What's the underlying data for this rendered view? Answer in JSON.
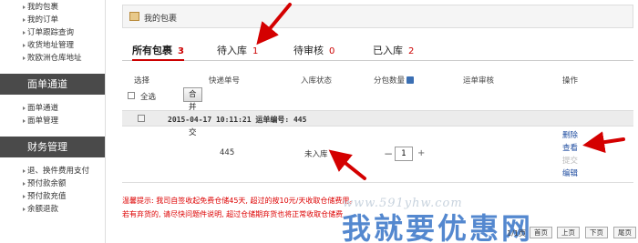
{
  "sidebar": {
    "group1": [
      "我的包裹",
      "我的订单",
      "订单跟踪查询",
      "收货地址管理",
      "败欧洲仓库地址"
    ],
    "section2": "面单通道",
    "group2": [
      "面单通道",
      "面单管理"
    ],
    "section3": "财务管理",
    "group3": [
      "退、换件费用支付",
      "预付款余额",
      "预付款充值",
      "余额退款"
    ]
  },
  "panel": {
    "title": "我的包裹"
  },
  "tabs": [
    {
      "label": "所有包裹",
      "count": "3"
    },
    {
      "label": "待入库",
      "count": "1"
    },
    {
      "label": "待审核",
      "count": "0"
    },
    {
      "label": "已入库",
      "count": "2"
    }
  ],
  "columns": {
    "select": "选择",
    "tracking": "快递单号",
    "status": "入库状态",
    "quantity": "分包数量",
    "waybill_review": "运单审核",
    "actions": "操作"
  },
  "toolbar": {
    "select_all": "全选",
    "merge_submit": "合并提交"
  },
  "order": {
    "info": "2015-04-17 10:11:21 运单编号: 445"
  },
  "row": {
    "tracking": "445",
    "status": "未入库",
    "quantity": "1",
    "minus": "−",
    "plus": "+",
    "actions": {
      "delete": "删除",
      "view": "查看",
      "submit": "提交",
      "edit": "编辑"
    }
  },
  "tips": {
    "line1": "温馨提示: 我司自签收起免费仓储45天, 超过的按10元/天收取仓储费用。",
    "line2": "若有弃货的, 请尽快问题件说明, 超过仓储期弃货也将正常收取仓储费"
  },
  "pager": {
    "text": "1/1页",
    "first": "首页",
    "prev": "上页",
    "next": "下页",
    "last": "尾页"
  },
  "watermark": {
    "url": "www.591yhw.com",
    "cn": "我就要优惠网"
  },
  "colors": {
    "accent_red": "#cc0000",
    "link_blue": "#1f4da0",
    "sidebar_header": "#4a4a4a"
  }
}
